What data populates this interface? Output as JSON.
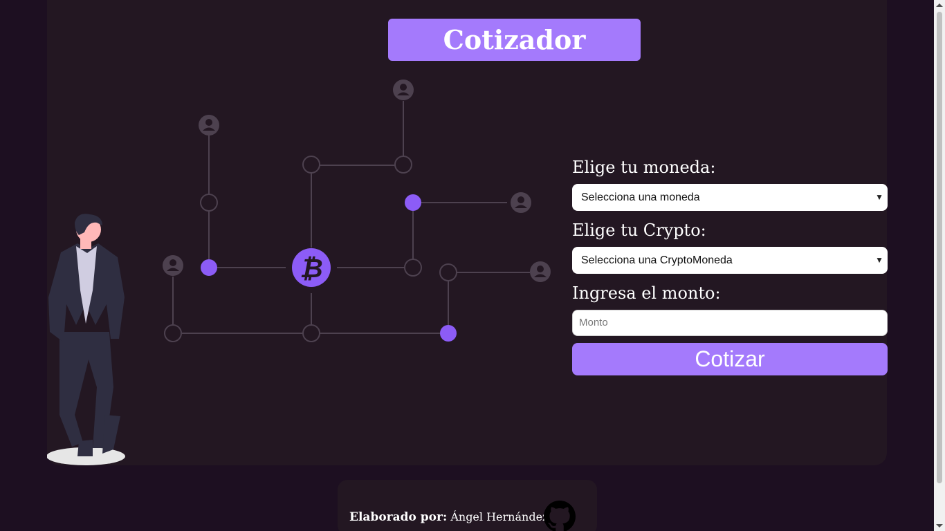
{
  "header": {
    "title": "Cotizador"
  },
  "form": {
    "currency_label": "Elige tu moneda:",
    "currency_selected": "Selecciona una moneda",
    "crypto_label": "Elige tu Crypto:",
    "crypto_selected": "Selecciona una CryptoMoneda",
    "amount_label": "Ingresa el monto:",
    "amount_placeholder": "Monto",
    "submit_label": "Cotizar"
  },
  "footer": {
    "made_by_label": "Elaborado por:",
    "author": "Ángel Hernández",
    "icon": "github-icon"
  },
  "colors": {
    "background": "#1d0f21",
    "card": "#231722",
    "accent": "#a47afc",
    "node_filled": "#8c5cf6",
    "line": "#4a3e4c"
  }
}
